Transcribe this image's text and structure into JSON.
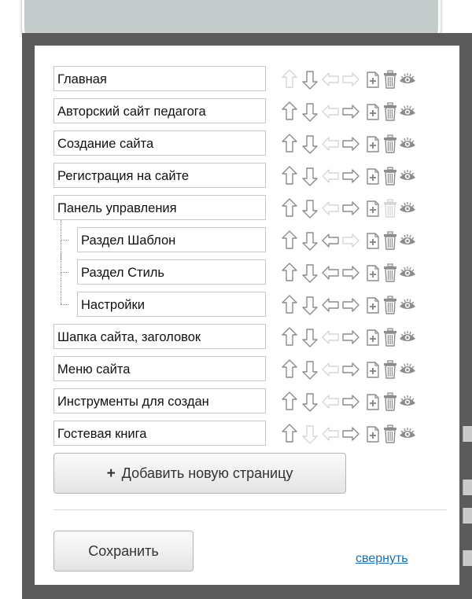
{
  "pages": [
    {
      "title": "Главная",
      "level": 0,
      "actions": [
        "disabled",
        "enabled",
        "disabled",
        "disabled",
        "enabled",
        "enabled",
        "enabled"
      ]
    },
    {
      "title": "Авторский сайт педагога",
      "level": 0,
      "actions": [
        "enabled",
        "enabled",
        "disabled",
        "enabled",
        "enabled",
        "enabled",
        "enabled"
      ]
    },
    {
      "title": "Создание сайта",
      "level": 0,
      "actions": [
        "enabled",
        "enabled",
        "disabled",
        "enabled",
        "enabled",
        "enabled",
        "enabled"
      ]
    },
    {
      "title": "Регистрация на сайте",
      "level": 0,
      "actions": [
        "enabled",
        "enabled",
        "disabled",
        "enabled",
        "enabled",
        "enabled",
        "enabled"
      ]
    },
    {
      "title": "Панель управления",
      "level": 0,
      "actions": [
        "enabled",
        "enabled",
        "disabled",
        "enabled",
        "enabled",
        "disabled",
        "enabled"
      ]
    },
    {
      "title": "Раздел Шаблон",
      "level": 1,
      "actions": [
        "enabled",
        "enabled",
        "enabled",
        "disabled",
        "enabled",
        "enabled",
        "enabled"
      ]
    },
    {
      "title": "Раздел Стиль",
      "level": 1,
      "actions": [
        "enabled",
        "enabled",
        "enabled",
        "enabled",
        "enabled",
        "enabled",
        "enabled"
      ]
    },
    {
      "title": "Настройки",
      "level": 1,
      "actions": [
        "enabled",
        "enabled",
        "enabled",
        "enabled",
        "enabled",
        "enabled",
        "enabled"
      ]
    },
    {
      "title": "Шапка сайта, заголовок",
      "level": 0,
      "actions": [
        "enabled",
        "enabled",
        "disabled",
        "enabled",
        "enabled",
        "enabled",
        "enabled"
      ]
    },
    {
      "title": "Меню сайта",
      "level": 0,
      "actions": [
        "enabled",
        "enabled",
        "disabled",
        "enabled",
        "enabled",
        "enabled",
        "enabled"
      ]
    },
    {
      "title": "Инструменты для создан",
      "level": 0,
      "actions": [
        "enabled",
        "enabled",
        "disabled",
        "enabled",
        "enabled",
        "enabled",
        "enabled"
      ]
    },
    {
      "title": "Гостевая книга",
      "level": 0,
      "actions": [
        "enabled",
        "disabled",
        "disabled",
        "enabled",
        "enabled",
        "enabled",
        "enabled"
      ]
    }
  ],
  "action_icons": [
    "arrow-up-icon",
    "arrow-down-icon",
    "arrow-left-icon",
    "arrow-right-icon",
    "add-page-icon",
    "trash-icon",
    "eye-icon"
  ],
  "add_page_button": {
    "plus": "+",
    "label": "Добавить новую страницу"
  },
  "save_button": {
    "label": "Сохранить"
  },
  "collapse_link": {
    "label": "свернуть"
  },
  "colors": {
    "frame": "#5a5a5a",
    "top_panel": "#c3cccb",
    "link": "#1a6fb5",
    "icon_enabled": "#8c8c8c",
    "icon_disabled": "#d6d6d6"
  }
}
